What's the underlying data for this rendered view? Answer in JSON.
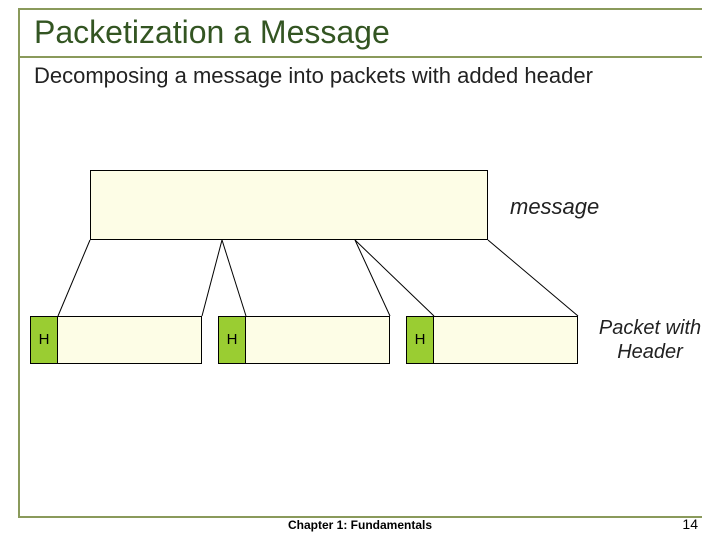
{
  "title": "Packetization a Message",
  "subtitle": "Decomposing a message into packets with added header",
  "message_label": "message",
  "packets": {
    "h1": "H",
    "h2": "H",
    "h3": "H"
  },
  "packet_label": "Packet with Header",
  "footer": {
    "center": "Chapter 1: Fundamentals",
    "page": "14"
  }
}
